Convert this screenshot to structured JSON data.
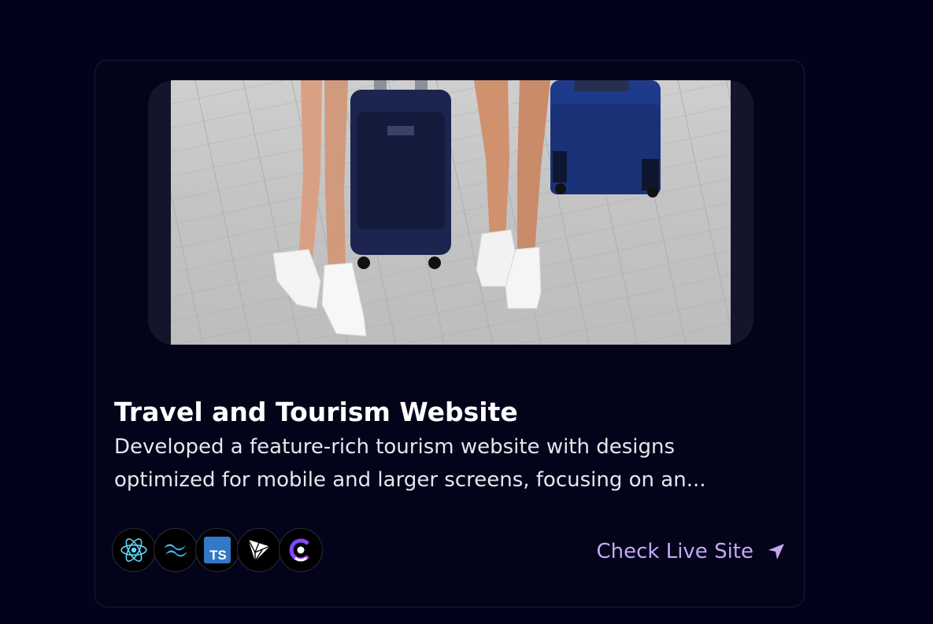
{
  "project": {
    "title": "Travel and Tourism Website",
    "description": "Developed a feature-rich tourism website with designs optimized for mobile and larger screens, focusing on an...",
    "live_link_label": "Check Live Site"
  },
  "tech_icons": [
    {
      "name": "react-icon"
    },
    {
      "name": "tailwind-icon"
    },
    {
      "name": "typescript-icon",
      "text": "TS"
    },
    {
      "name": "three-js-icon"
    },
    {
      "name": "clerk-icon"
    }
  ],
  "colors": {
    "background": "#02031a",
    "card_border": "#1a1c35",
    "accent": "#c6a7f5",
    "react": "#61dafb",
    "tailwind": "#38bdf8",
    "typescript": "#3178c6"
  }
}
